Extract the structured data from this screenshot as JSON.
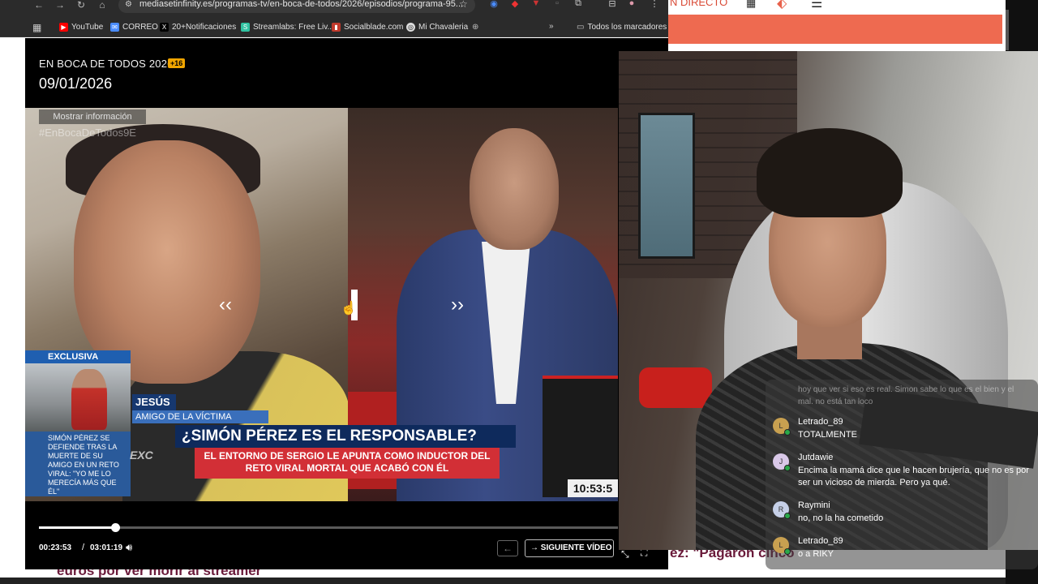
{
  "browser": {
    "url": "mediasetinfinity.es/programas-tv/en-boca-de-todos/2026/episodios/programa-95...",
    "bookmarks": [
      {
        "label": "YouTube",
        "icon": "youtube-icon",
        "color": "#ff0000"
      },
      {
        "label": "CORREO",
        "icon": "mail-icon",
        "color": "#4a8cff"
      },
      {
        "label": "20+Notificaciones",
        "icon": "x-icon",
        "color": "#000000"
      },
      {
        "label": "Streamlabs: Free Liv...",
        "icon": "streamlabs-icon",
        "color": "#31c3a2"
      },
      {
        "label": "Socialblade.com",
        "icon": "socialblade-icon",
        "color": "#c0392b"
      },
      {
        "label": "Mi Chavaleria",
        "icon": "link-icon",
        "color": "#dddddd"
      }
    ],
    "all_bookmarks": "Todos los marcadores"
  },
  "site": {
    "live_label": "N DIRECTO",
    "bottom_headline_left": "euros por ver morir al streamer",
    "bottom_headline_right": "ez: \"Pagaron cinco",
    "accent": "#ee6a50"
  },
  "player": {
    "show_title": "EN BOCA DE TODOS 2026",
    "age_rating": "+16",
    "episode_date": "09/01/2026",
    "show_info": "Mostrar información",
    "hashtag": "#EnBocaDeTodos9E",
    "exclusive_label": "EXCLUSIVA",
    "exclusive_desc": "SIMÓN PÉREZ SE DEFIENDE TRAS LA MUERTE DE SU AMIGO EN UN RETO VIRAL: \"YO ME LO MERECÍA MÁS QUE ÉL\"",
    "person_name": "JESÚS",
    "person_role": "AMIGO DE LA VÍCTIMA",
    "headline": "¿SIMÓN PÉREZ ES EL RESPONSABLE?",
    "subheadline": "EL ENTORNO DE SERGIO LE APUNTA COMO INDUCTOR DEL RETO VIRAL MORTAL QUE ACABÓ CON ÉL",
    "excl_band": "EXC",
    "clock": "10:53:5",
    "current_time": "00:23:53",
    "separator": "/",
    "total_time": "03:01:19",
    "progress": 0.132,
    "next_label": "SIGUIENTE VÍDEO",
    "skip_back": "‹‹",
    "skip_forward": "››"
  },
  "chat": {
    "faded": "hoy que ver si eso es real. Simon sabe lo que es el bien y el mal. no está tan loco",
    "messages": [
      {
        "user": "Letrado_89",
        "text": "TOTALMENTE",
        "avatar": "L",
        "avatar_color": "#c8a050"
      },
      {
        "user": "Jutdawie",
        "text": "Encima la mamá dice que le hacen brujería, que no es por ser un vicioso de mierda. Pero ya qué.",
        "avatar": "J",
        "avatar_color": "#d9c8e8"
      },
      {
        "user": "Raymini",
        "text": "no, no la ha cometido",
        "avatar": "R",
        "avatar_color": "#c6d0e8"
      },
      {
        "user": "Letrado_89",
        "text": "o a RIKY",
        "avatar": "L",
        "avatar_color": "#c8a050"
      }
    ]
  }
}
